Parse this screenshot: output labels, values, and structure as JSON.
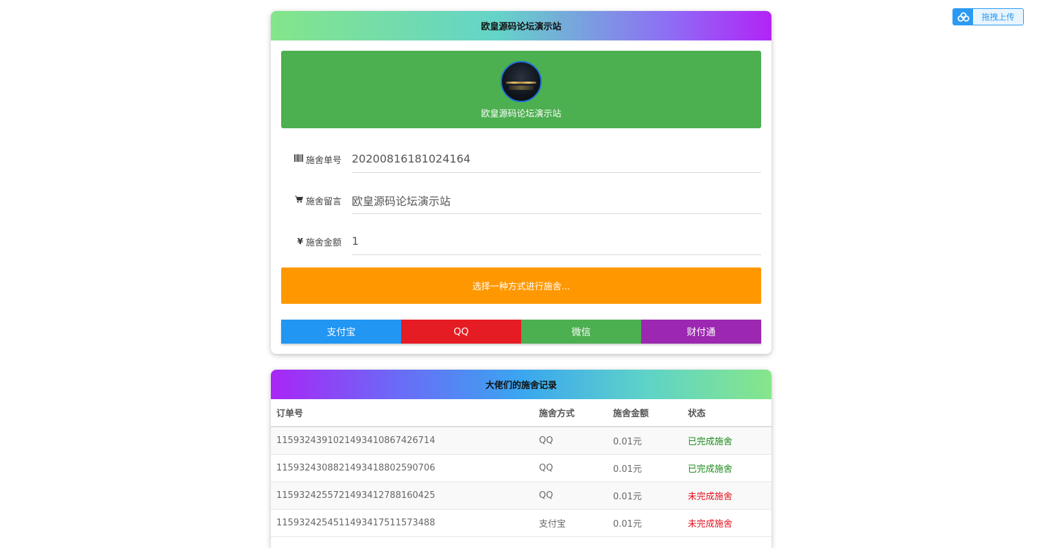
{
  "upload": {
    "label": "拖拽上传",
    "icon": "baidu-cloud-icon"
  },
  "pay_card": {
    "header_title": "欧皇源码论坛演示站",
    "banner_title": "欧皇源码论坛演示站",
    "fields": [
      {
        "label": "施舍单号",
        "icon": "barcode-icon",
        "value": "20200816181024164"
      },
      {
        "label": "施舍留言",
        "icon": "cart-icon",
        "value": "欧皇源码论坛演示站"
      },
      {
        "label": "施舍金额",
        "icon": "yen-icon",
        "value": "1"
      }
    ],
    "select_label": "选择一种方式进行施舍...",
    "methods": [
      {
        "label": "支付宝",
        "color": "#2196f3"
      },
      {
        "label": "QQ",
        "color": "#e51c23"
      },
      {
        "label": "微信",
        "color": "#4caf50"
      },
      {
        "label": "财付通",
        "color": "#9c27b0"
      }
    ],
    "colors": {
      "banner": "#4caf50",
      "select": "#ff9800"
    }
  },
  "records_card": {
    "header_title": "大佬们的施舍记录",
    "columns": [
      "订单号",
      "施舍方式",
      "施舍金额",
      "状态"
    ],
    "rows": [
      {
        "order": "115932439102149341086742671​4",
        "method": "QQ",
        "amount": "0.01元",
        "status": "已完成施舍",
        "done": true
      },
      {
        "order": "115932430882149341880259070​6",
        "method": "QQ",
        "amount": "0.01元",
        "status": "已完成施舍",
        "done": true
      },
      {
        "order": "115932425572149341278816042​5",
        "method": "QQ",
        "amount": "0.01元",
        "status": "未完成施舍",
        "done": false
      },
      {
        "order": "115932425451149341751157348​8",
        "method": "支付宝",
        "amount": "0.01元",
        "status": "未完成施舍",
        "done": false
      }
    ],
    "colors": {
      "done": "#1a8a1a",
      "undone": "#e3101d"
    }
  }
}
